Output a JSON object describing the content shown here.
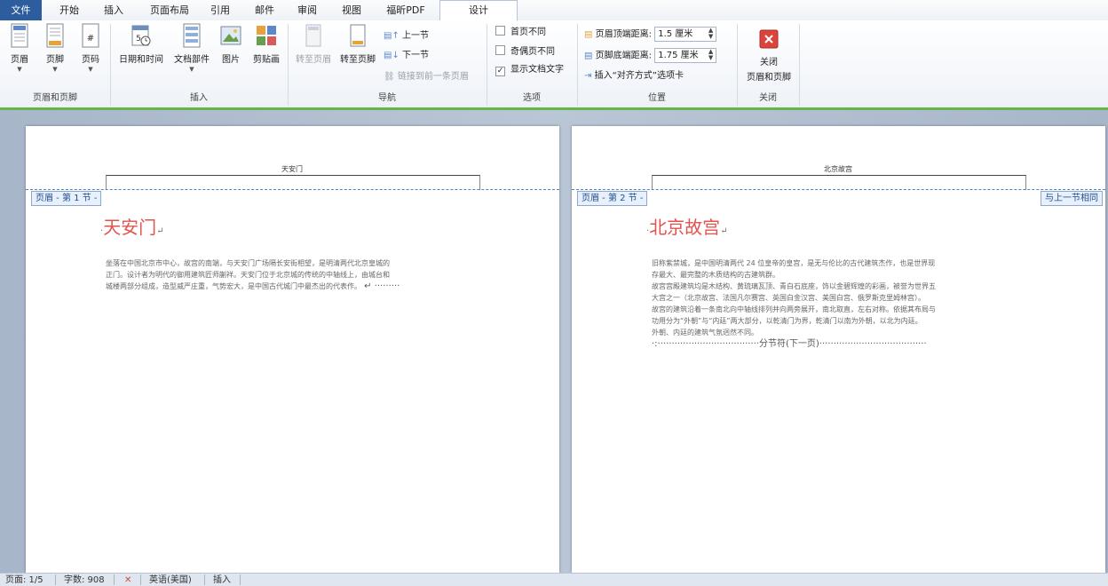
{
  "tabs": [
    "文件",
    "开始",
    "插入",
    "页面布局",
    "引用",
    "邮件",
    "审阅",
    "视图",
    "福昕PDF",
    "设计"
  ],
  "ribbon": {
    "groups": {
      "header_footer": "页眉和页脚",
      "insert": "插入",
      "nav": "导航",
      "options": "选项",
      "position": "位置",
      "close": "关闭"
    },
    "header": "页眉",
    "footer": "页脚",
    "page_number": "页码",
    "datetime": "日期和时间",
    "quickparts": "文档部件",
    "picture": "图片",
    "clipart": "剪贴画",
    "goto_header": "转至页眉",
    "goto_footer": "转至页脚",
    "prev_section": "上一节",
    "next_section": "下一节",
    "link_previous": "链接到前一条页眉",
    "diff_first": "首页不同",
    "diff_odd_even": "奇偶页不同",
    "show_doc_text": "显示文档文字",
    "header_top_label": "页眉顶端距离:",
    "header_top_value": "1.5 厘米",
    "footer_bottom_label": "页脚底端距离:",
    "footer_bottom_value": "1.75 厘米",
    "insert_align_tab": "插入“对齐方式”选项卡",
    "close_l1": "关闭",
    "close_l2": "页眉和页脚"
  },
  "page1": {
    "header_text": "天安门",
    "section_tag": "页眉 - 第 1 节 -",
    "title": "天安门",
    "lines": [
      "坐落在中国北京市中心，故宫的南端，与天安门广场隔长安街相望，是明清两代北京皇城的",
      "正门。设计者为明代的御用建筑匠师蒯祥。天安门位于北京城的传统的中轴线上，由城台和",
      "城楼两部分组成，造型威严庄重，气势宏大，是中国古代城门中最杰出的代表作。"
    ]
  },
  "page2": {
    "header_text": "北京故宫",
    "section_tag": "页眉 - 第 2 节 -",
    "same_as_prev": "与上一节相同",
    "title": "北京故宫",
    "lines": [
      "旧称紫禁城，是中国明清两代 24 位皇帝的皇宫，是无与伦比的古代建筑杰作，也是世界现",
      "存最大、最完整的木质结构的古建筑群。",
      "故宫宫殿建筑均是木结构、黄琉璃瓦顶、青白石底座，饰以金碧辉煌的彩画，被誉为世界五",
      "大宫之一（北京故宫、法国凡尔赛宫、英国白金汉宫、美国白宫、俄罗斯克里姆林宫）。",
      "故宫的建筑沿着一条南北向中轴线排列并向两旁展开，南北取直，左右对称。依据其布局与",
      "功用分为“外朝”与“内廷”两大部分，以乾清门为界，乾清门以南为外朝，以北为内廷。",
      "外朝、内廷的建筑气氛迥然不同。"
    ],
    "section_break": "分节符(下一页)"
  },
  "status": {
    "page": "页面: 1/5",
    "words": "字数: 908",
    "language": "英语(美国)",
    "mode": "插入"
  },
  "colors": {
    "file_tab": "#2d5c9f",
    "accent_bar": "#67b548",
    "title_red": "#e2534f",
    "header_dash": "#4f83c4"
  },
  "icons": [
    "header-icon",
    "footer-icon",
    "page-number-icon",
    "datetime-icon",
    "quickparts-icon",
    "picture-icon",
    "clipart-icon",
    "goto-header-icon",
    "goto-footer-icon",
    "prev-section-icon",
    "next-section-icon",
    "link-icon",
    "close-x-icon",
    "proofing-icon"
  ]
}
